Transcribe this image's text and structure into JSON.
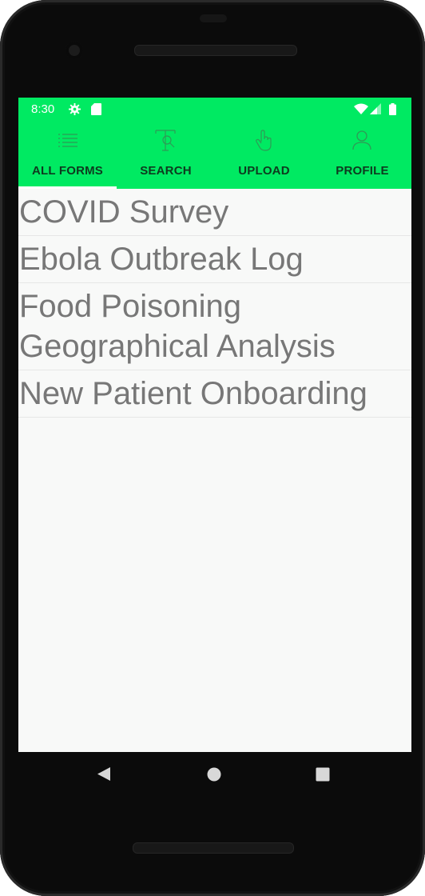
{
  "status_bar": {
    "time": "8:30",
    "icons": [
      "gear-icon",
      "sd-card-icon",
      "wifi-icon",
      "signal-icon",
      "battery-icon"
    ]
  },
  "tabs": [
    {
      "label": "ALL FORMS",
      "icon": "list-icon",
      "selected": true
    },
    {
      "label": "SEARCH",
      "icon": "text-search-icon",
      "selected": false
    },
    {
      "label": "UPLOAD",
      "icon": "touch-icon",
      "selected": false
    },
    {
      "label": "PROFILE",
      "icon": "person-icon",
      "selected": false
    }
  ],
  "forms": [
    "COVID Survey",
    "Ebola Outbreak Log",
    "Food Poisoning Geographical Analysis",
    "New Patient Onboarding"
  ],
  "nav": [
    "back-icon",
    "home-icon",
    "recents-icon"
  ],
  "colors": {
    "accent": "#00ea62",
    "list_text": "#777777",
    "tab_text": "#0e3a1f",
    "background": "#f8f9f8"
  }
}
